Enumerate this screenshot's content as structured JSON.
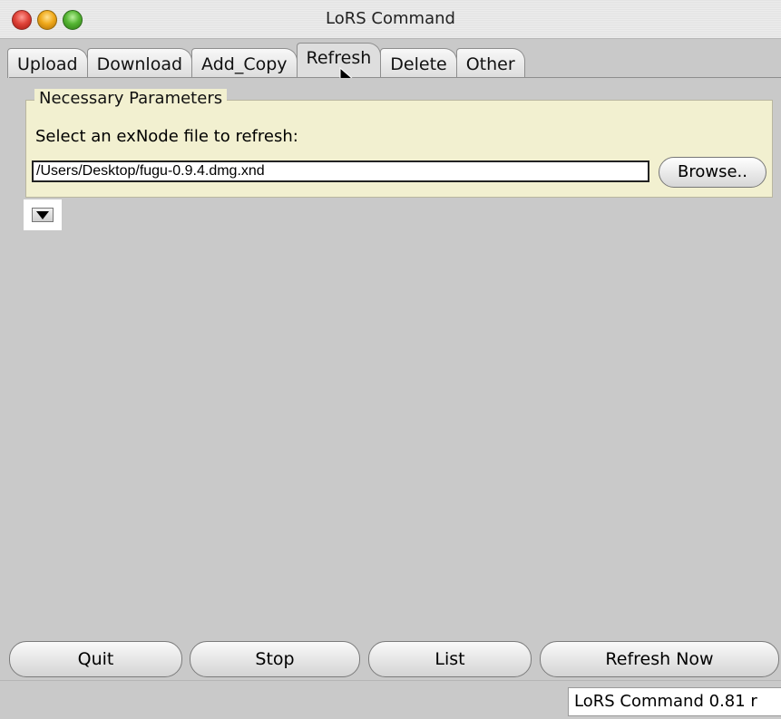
{
  "window": {
    "title": "LoRS Command"
  },
  "tabs": [
    {
      "label": "Upload"
    },
    {
      "label": "Download"
    },
    {
      "label": "Add_Copy"
    },
    {
      "label": "Refresh"
    },
    {
      "label": "Delete"
    },
    {
      "label": "Other"
    }
  ],
  "active_tab": "Refresh",
  "necessary_parameters": {
    "legend": "Necessary Parameters",
    "prompt": "Select an exNode file to refresh:",
    "file_path": "/Users/Desktop/fugu-0.9.4.dmg.xnd",
    "browse_label": "Browse.."
  },
  "actions": {
    "quit_label": "Quit",
    "stop_label": "Stop",
    "list_label": "List",
    "refresh_now_label": "Refresh Now"
  },
  "status": {
    "version_text": "LoRS Command 0.81 r"
  },
  "icons": {
    "expand": "triangle-down-icon",
    "cursor": "arrow-cursor-icon"
  },
  "colors": {
    "panel_background": "#c9c9c9",
    "fieldset_background": "#f2f0d0"
  }
}
